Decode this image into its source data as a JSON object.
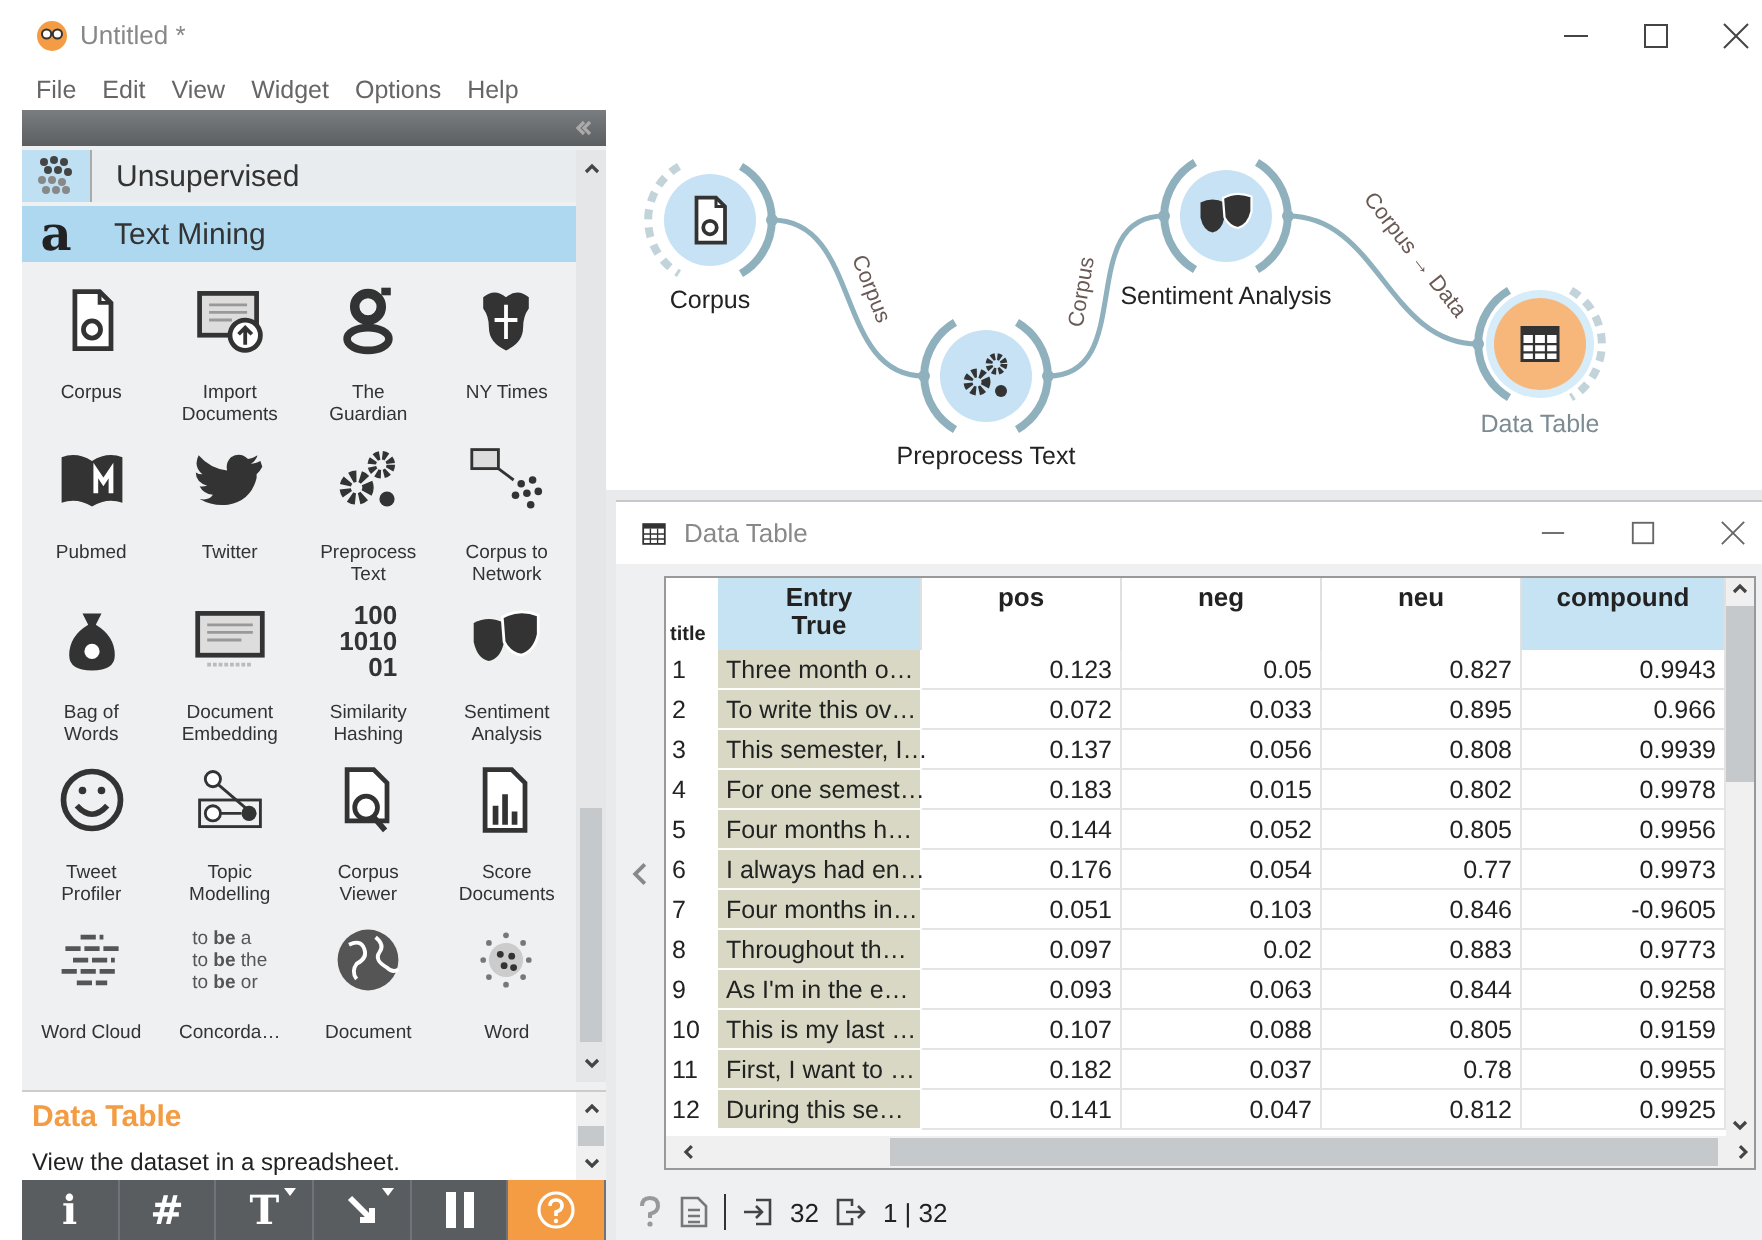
{
  "window": {
    "title": "Untitled *"
  },
  "menu": [
    "File",
    "Edit",
    "View",
    "Widget",
    "Options",
    "Help"
  ],
  "toolbox": {
    "categories": [
      {
        "label": "Unsupervised",
        "selected": false
      },
      {
        "label": "Text Mining",
        "selected": true,
        "icon_char": "a"
      }
    ],
    "widgets": [
      {
        "label": "Corpus"
      },
      {
        "label": "Import\nDocuments"
      },
      {
        "label": "The\nGuardian"
      },
      {
        "label": "NY Times"
      },
      {
        "label": "Pubmed"
      },
      {
        "label": "Twitter"
      },
      {
        "label": "Preprocess\nText"
      },
      {
        "label": "Corpus to\nNetwork"
      },
      {
        "label": "Bag of\nWords"
      },
      {
        "label": "Document\nEmbedding"
      },
      {
        "label": "Similarity\nHashing",
        "icon_lines": [
          "100",
          "1010",
          "01"
        ]
      },
      {
        "label": "Sentiment\nAnalysis"
      },
      {
        "label": "Tweet\nProfiler"
      },
      {
        "label": "Topic\nModelling"
      },
      {
        "label": "Corpus\nViewer"
      },
      {
        "label": "Score\nDocuments"
      },
      {
        "label": "Word Cloud"
      },
      {
        "label": "Concorda…",
        "icon_lines": [
          "to **be** a",
          "to **be** the",
          "to **be** or"
        ]
      },
      {
        "label": "Document"
      },
      {
        "label": "Word"
      }
    ]
  },
  "description": {
    "title": "Data Table",
    "text": "View the dataset in a spreadsheet."
  },
  "toolbar": [
    {
      "kind": "glyph",
      "glyph": "i",
      "menu": false
    },
    {
      "kind": "glyph",
      "glyph": "#",
      "menu": false
    },
    {
      "kind": "glyph",
      "glyph": "T",
      "menu": true
    },
    {
      "kind": "arrow",
      "menu": true
    },
    {
      "kind": "pause",
      "menu": false
    },
    {
      "kind": "help",
      "menu": false
    }
  ],
  "canvas": {
    "nodes": [
      {
        "label": "Corpus",
        "selected": false
      },
      {
        "label": "Preprocess Text",
        "selected": false
      },
      {
        "label": "Sentiment Analysis",
        "selected": false
      },
      {
        "label": "Data Table",
        "selected": true
      }
    ],
    "links": [
      {
        "label": "Corpus"
      },
      {
        "label": "Corpus"
      },
      {
        "label": "Corpus → Data"
      }
    ]
  },
  "data_table": {
    "title": "Data Table",
    "row_header": "title",
    "columns": [
      {
        "label": "Entry\nTrue",
        "selected": true
      },
      {
        "label": "pos",
        "selected": false
      },
      {
        "label": "neg",
        "selected": false
      },
      {
        "label": "neu",
        "selected": false
      },
      {
        "label": "compound",
        "selected": true
      }
    ],
    "rows": [
      {
        "index": "1",
        "cells": [
          "Three month o…",
          "0.123",
          "0.05",
          "0.827",
          "0.9943"
        ]
      },
      {
        "index": "2",
        "cells": [
          "To write this ov…",
          "0.072",
          "0.033",
          "0.895",
          "0.966"
        ]
      },
      {
        "index": "3",
        "cells": [
          "This semester, I…",
          "0.137",
          "0.056",
          "0.808",
          "0.9939"
        ]
      },
      {
        "index": "4",
        "cells": [
          "For one semest…",
          "0.183",
          "0.015",
          "0.802",
          "0.9978"
        ]
      },
      {
        "index": "5",
        "cells": [
          "Four months h…",
          "0.144",
          "0.052",
          "0.805",
          "0.9956"
        ]
      },
      {
        "index": "6",
        "cells": [
          "I always had en…",
          "0.176",
          "0.054",
          "0.77",
          "0.9973"
        ]
      },
      {
        "index": "7",
        "cells": [
          "Four months in…",
          "0.051",
          "0.103",
          "0.846",
          "-0.9605"
        ]
      },
      {
        "index": "8",
        "cells": [
          "Throughout th…",
          "0.097",
          "0.02",
          "0.883",
          "0.9773"
        ]
      },
      {
        "index": "9",
        "cells": [
          "As I'm in the e…",
          "0.093",
          "0.063",
          "0.844",
          "0.9258"
        ]
      },
      {
        "index": "10",
        "cells": [
          "This is my last …",
          "0.107",
          "0.088",
          "0.805",
          "0.9159"
        ]
      },
      {
        "index": "11",
        "cells": [
          "First, I want to …",
          "0.182",
          "0.037",
          "0.78",
          "0.9955"
        ]
      },
      {
        "index": "12",
        "cells": [
          "During this se…",
          "0.141",
          "0.047",
          "0.812",
          "0.9925"
        ]
      }
    ],
    "status": {
      "inputs": "32",
      "outputs": "1 | 32"
    }
  }
}
